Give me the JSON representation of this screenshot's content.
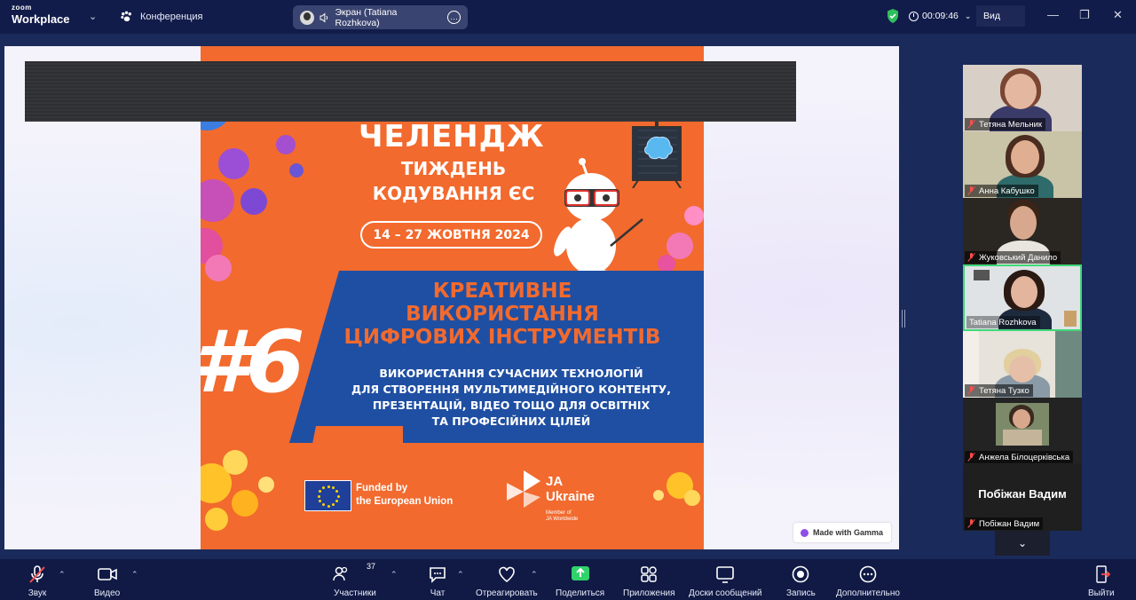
{
  "titlebar": {
    "brand_top": "zoom",
    "brand_bottom": "Workplace",
    "meeting_label": "Конференция",
    "share_label": "Экран (Tatiana Rozhkova)",
    "timer": "00:09:46",
    "view_label": "Вид"
  },
  "slide": {
    "title": "ЧЕЛЕНДЖ",
    "subtitle_line1": "ТИЖДЕНЬ",
    "subtitle_line2": "КОДУВАННЯ ЄС",
    "dates": "14 – 27 ЖОВТНЯ 2024",
    "number": "#6",
    "headline_line1": "КРЕАТИВНЕ",
    "headline_line2": "ВИКОРИСТАННЯ",
    "headline_line3": "ЦИФРОВИХ ІНСТРУМЕНТІВ",
    "body_line1": "ВИКОРИСТАННЯ СУЧАСНИХ ТЕХНОЛОГІЙ",
    "body_line2": "ДЛЯ СТВОРЕННЯ МУЛЬТИМЕДІЙНОГО КОНТЕНТУ,",
    "body_line3": "ПРЕЗЕНТАЦІЙ, ВІДЕО ТОЩО ДЛЯ ОСВІТНІХ",
    "body_line4": "ТА ПРОФЕСІЙНИХ ЦІЛЕЙ",
    "eu_line1": "Funded by",
    "eu_line2": "the European Union",
    "ja_line1": "JA",
    "ja_line2": "Ukraine",
    "ja_sub1": "Member of",
    "ja_sub2": "JA Worldwide",
    "badge": "Made with Gamma",
    "accent_color": "#f26a2e",
    "panel_color": "#1f4fa3"
  },
  "participants": [
    {
      "name": "Тетяна Мельник",
      "muted": true
    },
    {
      "name": "Анна Кабушко",
      "muted": true
    },
    {
      "name": "Жуковський Данило",
      "muted": true
    },
    {
      "name": "Tatiana Rozhkova",
      "muted": false,
      "active": true
    },
    {
      "name": "Тетяна Тузко",
      "muted": true
    },
    {
      "name": "Анжела Білоцерківська",
      "muted": true
    },
    {
      "name": "Побіжан Вадим",
      "muted": true,
      "display_name": "Побіжан Вадим"
    }
  ],
  "toolbar": {
    "audio": "Звук",
    "video": "Видео",
    "participants": "Участники",
    "participants_count": "37",
    "chat": "Чат",
    "react": "Отреагировать",
    "share": "Поделиться",
    "apps": "Приложения",
    "whiteboards": "Доски сообщений",
    "record": "Запись",
    "more": "Дополнительно",
    "leave": "Выйти"
  }
}
